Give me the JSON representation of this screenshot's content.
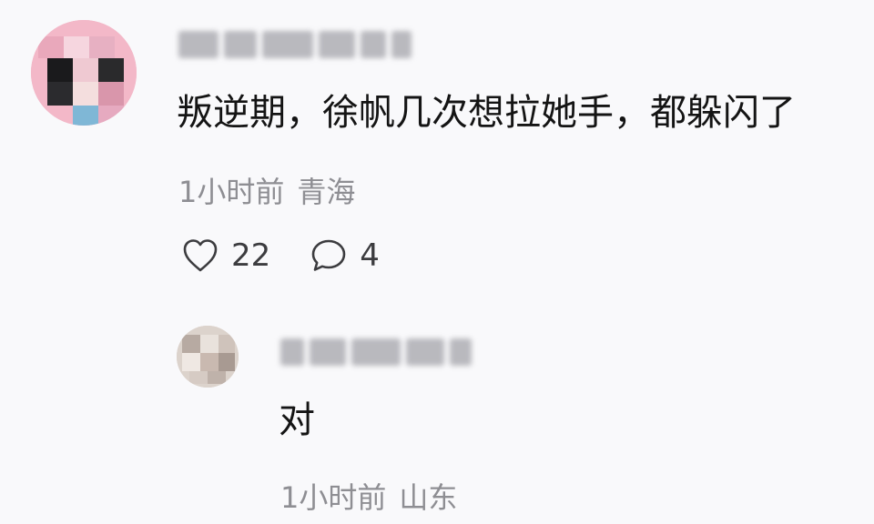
{
  "comment": {
    "text": "叛逆期，徐帆几次想拉她手，都躲闪了",
    "time": "1小时前",
    "location": "青海",
    "likes": "22",
    "replies": "4"
  },
  "reply": {
    "text": "对",
    "time": "1小时前",
    "location": "山东"
  },
  "icons": {
    "like": "heart-icon",
    "reply": "comment-bubble-icon"
  }
}
